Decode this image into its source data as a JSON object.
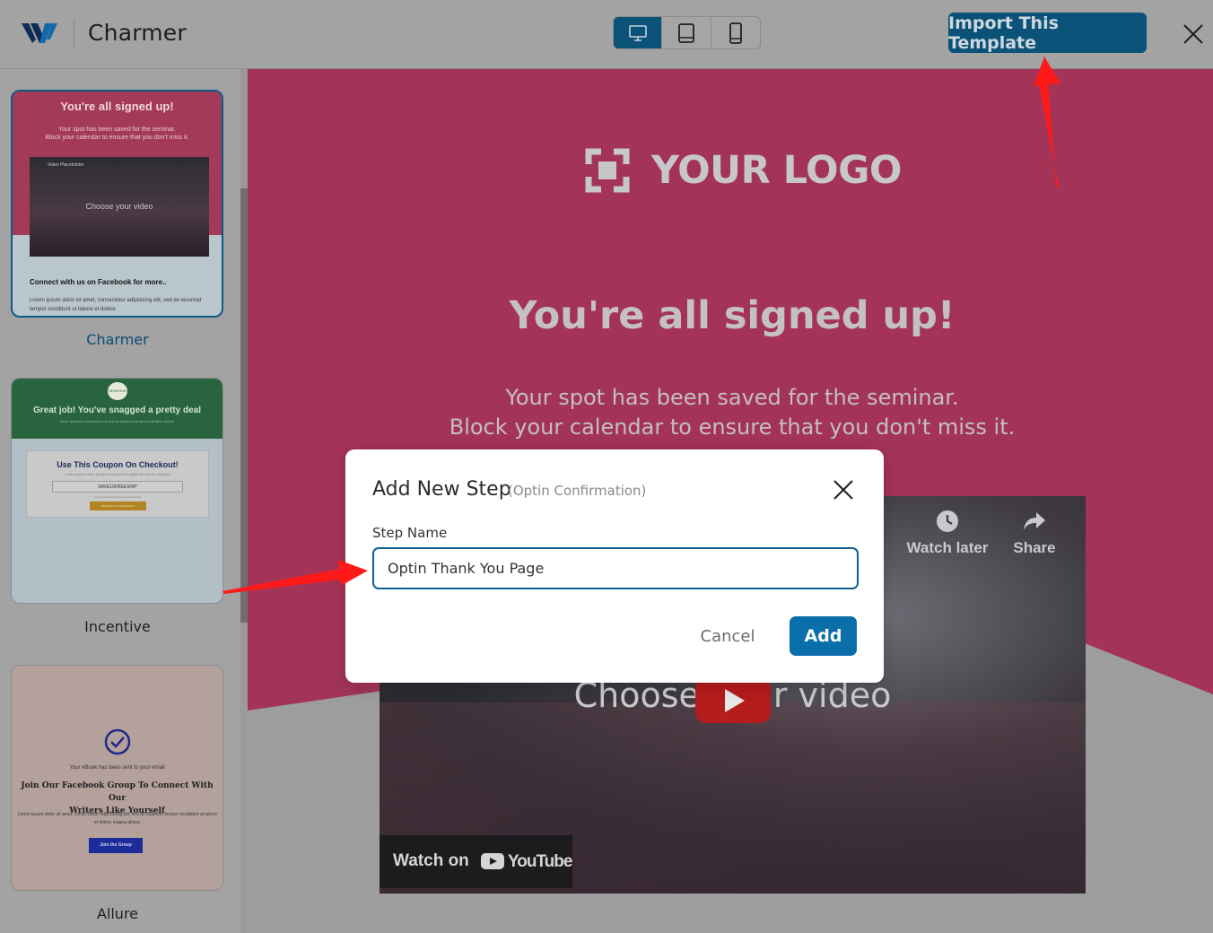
{
  "header": {
    "brand_name": "Charmer",
    "import_button": "Import This Template",
    "devices": [
      "desktop-icon",
      "tablet-icon",
      "mobile-icon"
    ],
    "active_device": "desktop"
  },
  "sidebar": {
    "templates": [
      {
        "label": "Charmer",
        "selected": true,
        "thumb_title": "You're all signed up!",
        "thumb_sub1": "Your spot has been saved for the seminar.",
        "thumb_sub2": "Block your calendar to ensure that you don't miss it.",
        "thumb_video_label": "Video Placeholder",
        "thumb_video_text": "Choose your video",
        "thumb_footer": "Connect with us on Facebook for more..",
        "thumb_lorem": "Lorem ipsum dolor sit amet, consectetur adipisicing elit, sed do eiusmod tempor incididunt ut labore et dolore"
      },
      {
        "label": "Incentive",
        "selected": false,
        "thumb_badge": "SEMI-RUN",
        "thumb_title": "Great job! You've snagged a pretty deal",
        "thumb_sub": "Dolor sit amet consectetur elit sed do eiusmod tempor incid labor dolore",
        "thumb_box_title": "Use This Coupon On Checkout!",
        "thumb_box_sub": "Lorem ipsum dolor sit amet consectetur adipis elit sed do eiusmod",
        "thumb_code": "SAVE10FREESHIP",
        "thumb_box_note": "Lorem ipsum dolor sit amet consectetur",
        "thumb_btn": "PROCEED TO CHECKOUT"
      },
      {
        "label": "Allure",
        "selected": false,
        "thumb_t1": "Your eBook has been sent to your email",
        "thumb_t2a": "Join Our Facebook Group To Connect With Our",
        "thumb_t2b": "Writers Like Yourself",
        "thumb_lorem": "Lorem ipsum dolor sit amet, conse ctetur odip isicing elit, sed do eiusmod tempor incididunt ut labore et dolore magna aliqua.",
        "thumb_btn": "Join the Group"
      }
    ]
  },
  "preview": {
    "logo_text": "YOUR LOGO",
    "title": "You're all signed up!",
    "subtitle_line1": "Your spot has been saved for the seminar.",
    "subtitle_line2": "Block your calendar to ensure that you don't miss it.",
    "video": {
      "center_text": "Choose your video",
      "watch_later": "Watch later",
      "share": "Share",
      "watch_on": "Watch on",
      "youtube": "YouTube"
    }
  },
  "modal": {
    "title": "Add New Step",
    "subtitle": "(Optin Confirmation)",
    "field_label": "Step Name",
    "field_value": "Optin Thank You Page",
    "cancel": "Cancel",
    "add": "Add"
  },
  "colors": {
    "accent": "#0a6eaa",
    "brand_pink": "#a33457",
    "annotation_arrow": "#ff1a1a"
  }
}
